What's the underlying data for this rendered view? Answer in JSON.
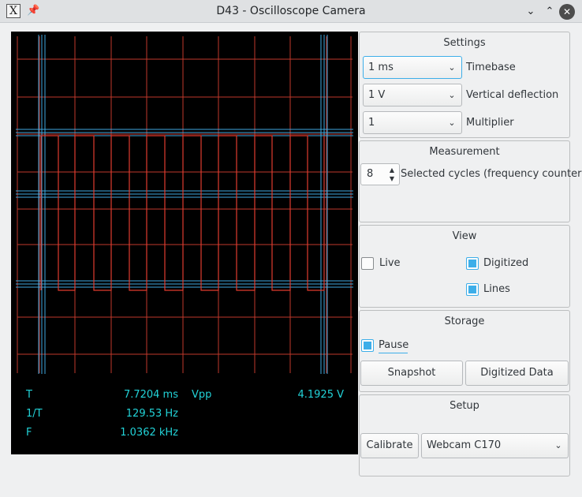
{
  "window": {
    "title": "D43 - Oscilloscope Camera",
    "app_icon": "X"
  },
  "scope": {
    "readouts": {
      "t_label": "T",
      "t_value": "7.7204 ms",
      "vpp_label": "Vpp",
      "vpp_value": "4.1925 V",
      "inv_t_label": "1/T",
      "inv_t_value": "129.53 Hz",
      "f_label": "F",
      "f_value": "1.0362 kHz"
    },
    "colors": {
      "background": "#000000",
      "grid": "#c0392b",
      "cursor_lines": "#3fa9e0",
      "trace": "#e03b2e",
      "readout_text": "#22d3d8"
    }
  },
  "settings": {
    "title": "Settings",
    "timebase": {
      "value": "1 ms",
      "label": "Timebase"
    },
    "vertical": {
      "value": "1 V",
      "label": "Vertical deflection"
    },
    "multiplier": {
      "value": "1",
      "label": "Multiplier"
    }
  },
  "measurement": {
    "title": "Measurement",
    "cycles": {
      "value": "8",
      "label": "Selected cycles (frequency counter)"
    }
  },
  "view": {
    "title": "View",
    "live": {
      "label": "Live",
      "checked": false
    },
    "digitized": {
      "label": "Digitized",
      "checked": true
    },
    "lines": {
      "label": "Lines",
      "checked": true
    }
  },
  "storage": {
    "title": "Storage",
    "pause": {
      "label": "Pause",
      "checked": true
    },
    "snapshot_label": "Snapshot",
    "digitized_data_label": "Digitized Data"
  },
  "setup": {
    "title": "Setup",
    "calibrate_label": "Calibrate",
    "camera": {
      "value": "Webcam C170"
    }
  },
  "icons": {
    "chevron": "chevron-down-icon",
    "pin": "pin-icon",
    "minimize": "minimize-icon",
    "maximize": "maximize-icon",
    "close": "close-icon"
  }
}
